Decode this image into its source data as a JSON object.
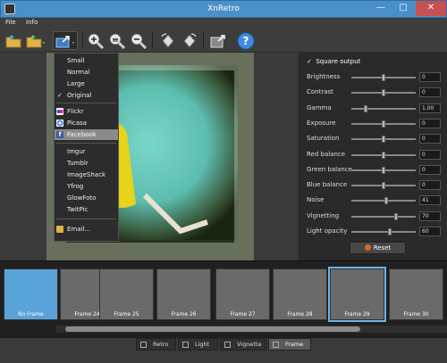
{
  "window": {
    "title": "XnRetro"
  },
  "menu": [
    "File",
    "Info"
  ],
  "toolbar": {
    "buttons": [
      "open-folder-icon",
      "export-folder-icon",
      "share-icon",
      "zoom-in-icon",
      "zoom-reset-icon",
      "zoom-out-icon",
      "rotate-left-icon",
      "rotate-right-icon",
      "fullscreen-icon",
      "help-icon"
    ]
  },
  "share_menu": {
    "sizes": [
      {
        "label": "Small",
        "checked": false
      },
      {
        "label": "Normal",
        "checked": false
      },
      {
        "label": "Large",
        "checked": false
      },
      {
        "label": "Original",
        "checked": true
      }
    ],
    "services": [
      {
        "label": "Flickr",
        "icon": "flickr-icon",
        "color": "#ff0084"
      },
      {
        "label": "Picasa",
        "icon": "picasa-icon",
        "color": "#4a90d9"
      },
      {
        "label": "Facebook",
        "icon": "facebook-icon",
        "color": "#3b5998",
        "selected": true
      }
    ],
    "other": [
      "Imgur",
      "Tumblr",
      "ImageShack",
      "Yfrog",
      "GlowFoto",
      "TwitPic"
    ],
    "email": "Email..."
  },
  "panel": {
    "square_output": "Square output",
    "adjustments": [
      {
        "label": "Brightness",
        "value": "0",
        "level": 0.5
      },
      {
        "label": "Contrast",
        "value": "0",
        "level": 0.5
      },
      {
        "label": "Gamma",
        "value": "1,00",
        "level": 0.2
      },
      {
        "label": "Exposure",
        "value": "0",
        "level": 0.5
      },
      {
        "label": "Saturation",
        "value": "0",
        "level": 0.5
      },
      {
        "label": "Red balance",
        "value": "0",
        "level": 0.5
      },
      {
        "label": "Green balance",
        "value": "0",
        "level": 0.5
      },
      {
        "label": "Blue balance",
        "value": "0",
        "level": 0.5
      },
      {
        "label": "Noise",
        "value": "41",
        "level": 0.55
      },
      {
        "label": "Vignetting",
        "value": "70",
        "level": 0.7
      },
      {
        "label": "Light opacity",
        "value": "60",
        "level": 0.6
      }
    ],
    "reset": "Reset"
  },
  "frames": [
    {
      "label": "No Frame",
      "selected": false
    },
    {
      "label": "Frame 24",
      "selected": false
    },
    {
      "label": "Frame 25",
      "selected": false
    },
    {
      "label": "Frame 26",
      "selected": false
    },
    {
      "label": "Frame 27",
      "selected": false
    },
    {
      "label": "Frame 28",
      "selected": false
    },
    {
      "label": "Frame 29",
      "selected": true
    },
    {
      "label": "Frame 30",
      "selected": false
    }
  ],
  "tabs": [
    {
      "label": "Retro",
      "active": false
    },
    {
      "label": "Light",
      "active": false
    },
    {
      "label": "Vignette",
      "active": false
    },
    {
      "label": "Frame",
      "active": true
    }
  ]
}
